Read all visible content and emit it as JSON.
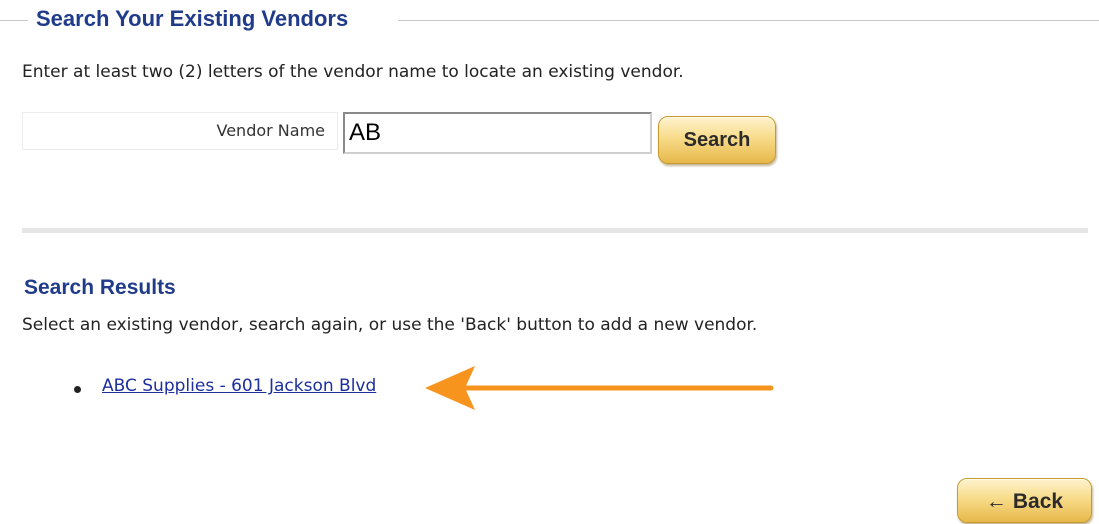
{
  "search_section": {
    "title": "Search Your Existing Vendors",
    "instructions": "Enter at least two (2) letters of the vendor name to locate an existing vendor.",
    "vendor_name_label": "Vendor Name",
    "vendor_name_value": "AB",
    "search_button_label": "Search"
  },
  "results_section": {
    "title": "Search Results",
    "instructions": "Select an existing vendor, search again, or use the 'Back' button to add a new vendor.",
    "results": [
      {
        "label": "ABC Supplies - 601 Jackson Blvd"
      }
    ]
  },
  "footer": {
    "back_button_icon": "←",
    "back_button_label": "Back"
  },
  "annotation": {
    "arrow_icon": "left-arrow-icon",
    "arrow_color": "#f7941d"
  },
  "colors": {
    "heading": "#1f3b8a",
    "link": "#1c2f9c",
    "button_gold": "#f8dc8a"
  }
}
